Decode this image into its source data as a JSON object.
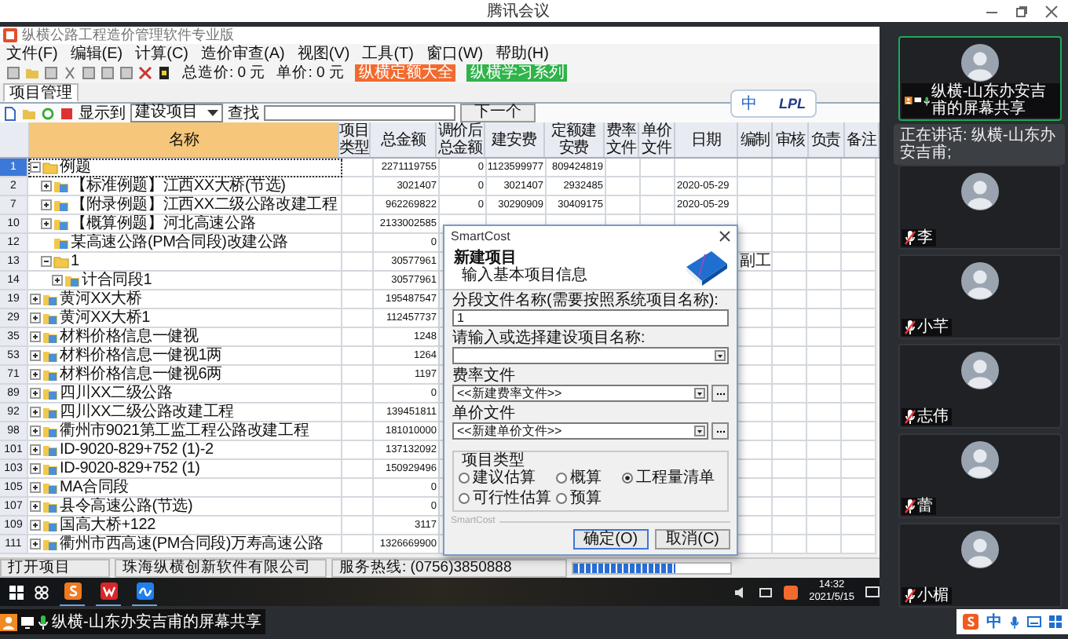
{
  "window": {
    "title": "腾讯会议"
  },
  "shared_app": {
    "title": "纵横公路工程造价管理软件专业版",
    "menu": [
      "文件(F)",
      "编辑(E)",
      "计算(C)",
      "造价审查(A)",
      "视图(V)",
      "工具(T)",
      "窗口(W)",
      "帮助(H)"
    ],
    "toolbar": {
      "total_cost": "总造价: 0 元",
      "unit_price": "单价: 0 元",
      "buttons": [
        {
          "label": "纵横定额大全",
          "color": "#f26a2e"
        },
        {
          "label": "纵横学习系列",
          "color": "#2fb34a"
        }
      ]
    },
    "ime_bar": {
      "mode": "中",
      "skin": "LPL"
    },
    "tabs": [
      {
        "label": "项目管理",
        "selected": true
      }
    ],
    "filter": {
      "show_label": "显示到",
      "show_value": "建设项目",
      "find_label": "查找",
      "next_button": "下一个"
    },
    "table": {
      "columns": [
        "名称",
        "项目类型",
        "总金额",
        "调价后总金额",
        "建安费",
        "定额建安费",
        "费率文件",
        "单价文件",
        "日期",
        "编制",
        "审核",
        "负责",
        "备注"
      ],
      "rows": [
        {
          "number": "1",
          "name": "例题",
          "kind": "folder",
          "expanded": true,
          "selected": true,
          "total": "2271119755",
          "adjusted_total": "0",
          "construction_cost": "1123599977",
          "quota_cost": "809424819",
          "children": [
            {
              "number": "2",
              "name": "【标准例题】江西XX大桥(节选)",
              "kind": "project",
              "expanded": false,
              "selected": false,
              "total": "3021407",
              "adjusted_total": "0",
              "construction_cost": "3021407",
              "quota_cost": "2932485",
              "date": "2020-05-29"
            },
            {
              "number": "7",
              "name": "【附录例题】江西XX二级公路改建工程",
              "kind": "project",
              "expanded": false,
              "selected": false,
              "total": "962269822",
              "adjusted_total": "0",
              "construction_cost": "30290909",
              "quota_cost": "30409175",
              "date": "2020-05-29"
            },
            {
              "number": "10",
              "name": "【概算例题】河北高速公路",
              "kind": "project",
              "expanded": false,
              "selected": false,
              "total": "2133002585"
            },
            {
              "number": "12",
              "name": "某高速公路(PM合同段)改建公路",
              "kind": "project",
              "selected": false,
              "total": "0"
            },
            {
              "number": "13",
              "name": "1",
              "kind": "folder",
              "expanded": true,
              "selected": false,
              "total": "30577961",
              "compiler": "副工",
              "children": [
                {
                  "number": "14",
                  "name": "计合同段1",
                  "kind": "project",
                  "expanded": false,
                  "selected": false,
                  "total": "30577961"
                }
              ]
            }
          ]
        },
        {
          "number": "19",
          "name": "黄河XX大桥",
          "kind": "project",
          "expanded": false,
          "selected": false,
          "total": "195487547"
        },
        {
          "number": "29",
          "name": "黄河XX大桥1",
          "kind": "project",
          "expanded": false,
          "selected": false,
          "total": "112457737"
        },
        {
          "number": "35",
          "name": "材料价格信息一健视",
          "kind": "project",
          "expanded": false,
          "selected": false,
          "total": "1248"
        },
        {
          "number": "53",
          "name": "材料价格信息一健视1两",
          "kind": "project",
          "expanded": false,
          "selected": false,
          "total": "1264"
        },
        {
          "number": "71",
          "name": "材料价格信息一健视6两",
          "kind": "project",
          "expanded": false,
          "selected": false,
          "total": "1197"
        },
        {
          "number": "89",
          "name": "四川XX二级公路",
          "kind": "project",
          "expanded": false,
          "selected": false,
          "total": "0"
        },
        {
          "number": "92",
          "name": "四川XX二级公路改建工程",
          "kind": "project",
          "expanded": false,
          "selected": false,
          "total": "139451811"
        },
        {
          "number": "98",
          "name": "衢州市9021第工监工程公路改建工程",
          "kind": "project",
          "expanded": false,
          "selected": false,
          "total": "181010000"
        },
        {
          "number": "101",
          "name": "ID-9020-829+752 (1)-2",
          "kind": "project",
          "expanded": false,
          "selected": false,
          "total": "137132092"
        },
        {
          "number": "103",
          "name": "ID-9020-829+752 (1)",
          "kind": "project",
          "expanded": false,
          "selected": false,
          "total": "150929496"
        },
        {
          "number": "105",
          "name": "MA合同段",
          "kind": "project",
          "expanded": false,
          "selected": false,
          "total": "0"
        },
        {
          "number": "107",
          "name": "县令高速公路(节选)",
          "kind": "project",
          "expanded": false,
          "selected": false,
          "total": "0"
        },
        {
          "number": "109",
          "name": "国高大桥+122",
          "kind": "project",
          "expanded": false,
          "selected": false,
          "total": "3117"
        },
        {
          "number": "111",
          "name": "衢州市西高速(PM合同段)万寿高速公路",
          "kind": "project",
          "expanded": false,
          "selected": false,
          "total": "1326669900"
        }
      ]
    },
    "dialog": {
      "title": "SmartCost",
      "heading": "新建项目",
      "subheading": "输入基本项目信息",
      "fields": [
        {
          "kind": "text",
          "label": "分段文件名称(需要按照系统项目名称):",
          "value": "1"
        },
        {
          "kind": "combo",
          "label": "请输入或选择建设项目名称:"
        },
        {
          "kind": "combo_browse",
          "label": "费率文件",
          "value": "<<新建费率文件>>"
        },
        {
          "kind": "combo_browse",
          "label": "单价文件",
          "value": "<<新建单价文件>>"
        }
      ],
      "group": {
        "label": "项目类型",
        "options": [
          {
            "label": "建议估算",
            "selected": false
          },
          {
            "label": "概算",
            "selected": false
          },
          {
            "label": "工程量清单",
            "selected": true
          },
          {
            "label": "可行性估算",
            "selected": false
          },
          {
            "label": "预算",
            "selected": false
          }
        ]
      },
      "footer": "SmartCost",
      "buttons": [
        "确定(O)",
        "取消(C)"
      ]
    },
    "status_bar": {
      "items": [
        "打开项目",
        "珠海纵横创新软件有限公司",
        "服务热线: (0756)3850888"
      ],
      "progress": {
        "level": 0.65
      }
    }
  },
  "taskbar": {
    "time": "14:32",
    "date": "2021/5/15"
  },
  "share_label": "纵横-山东办安吉甫的屏幕共享",
  "participants": [
    {
      "name": "纵横-山东办安吉甫的屏幕共享",
      "host": true,
      "sharing": true,
      "muted": false,
      "speaking": true
    },
    {
      "name": "李",
      "host": false,
      "sharing": false,
      "muted": true,
      "speaking": false
    },
    {
      "name": "小芊",
      "host": false,
      "sharing": false,
      "muted": true,
      "speaking": false
    },
    {
      "name": "志伟",
      "host": false,
      "sharing": false,
      "muted": true,
      "speaking": false
    },
    {
      "name": "蕾",
      "host": false,
      "sharing": false,
      "muted": true,
      "speaking": false
    },
    {
      "name": "小楣",
      "host": false,
      "sharing": false,
      "muted": true,
      "speaking": false
    }
  ],
  "speaking_tooltip": "正在讲话: 纵横-山东办安吉甫;",
  "ime": {
    "mode": "中"
  }
}
